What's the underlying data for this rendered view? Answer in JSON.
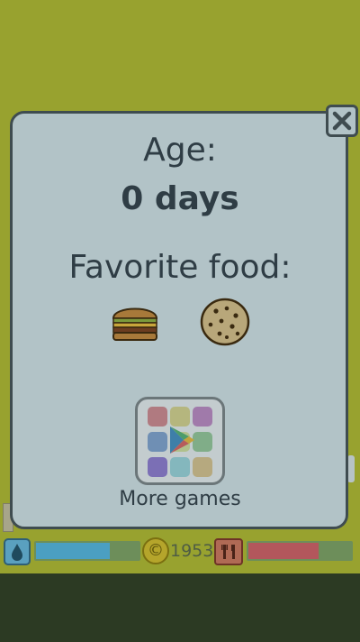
{
  "pet_info": {
    "age_label": "Age:",
    "age_value": "0 days",
    "favorite_food_label": "Favorite food:",
    "favorite_foods": [
      "burger-icon",
      "cookie-icon"
    ]
  },
  "more_games": {
    "label": "More games",
    "icon": "play-store-icon",
    "tile_colors": [
      "#b07a80",
      "#b5b67e",
      "#a07aaa",
      "#6f8fb4",
      "#b0c08b",
      "#80ad88",
      "#7b6fb5",
      "#84b7bd",
      "#b6a97f"
    ]
  },
  "hud": {
    "coins": "1953",
    "water_level": 0.72,
    "food_level": 0.68,
    "water_icon": "water-drop-icon",
    "food_icon": "fork-knife-icon",
    "coin_icon": "coin-icon"
  },
  "colors": {
    "panel": "#b2c3c7",
    "background": "#98a22f",
    "text": "#2f3d45"
  }
}
